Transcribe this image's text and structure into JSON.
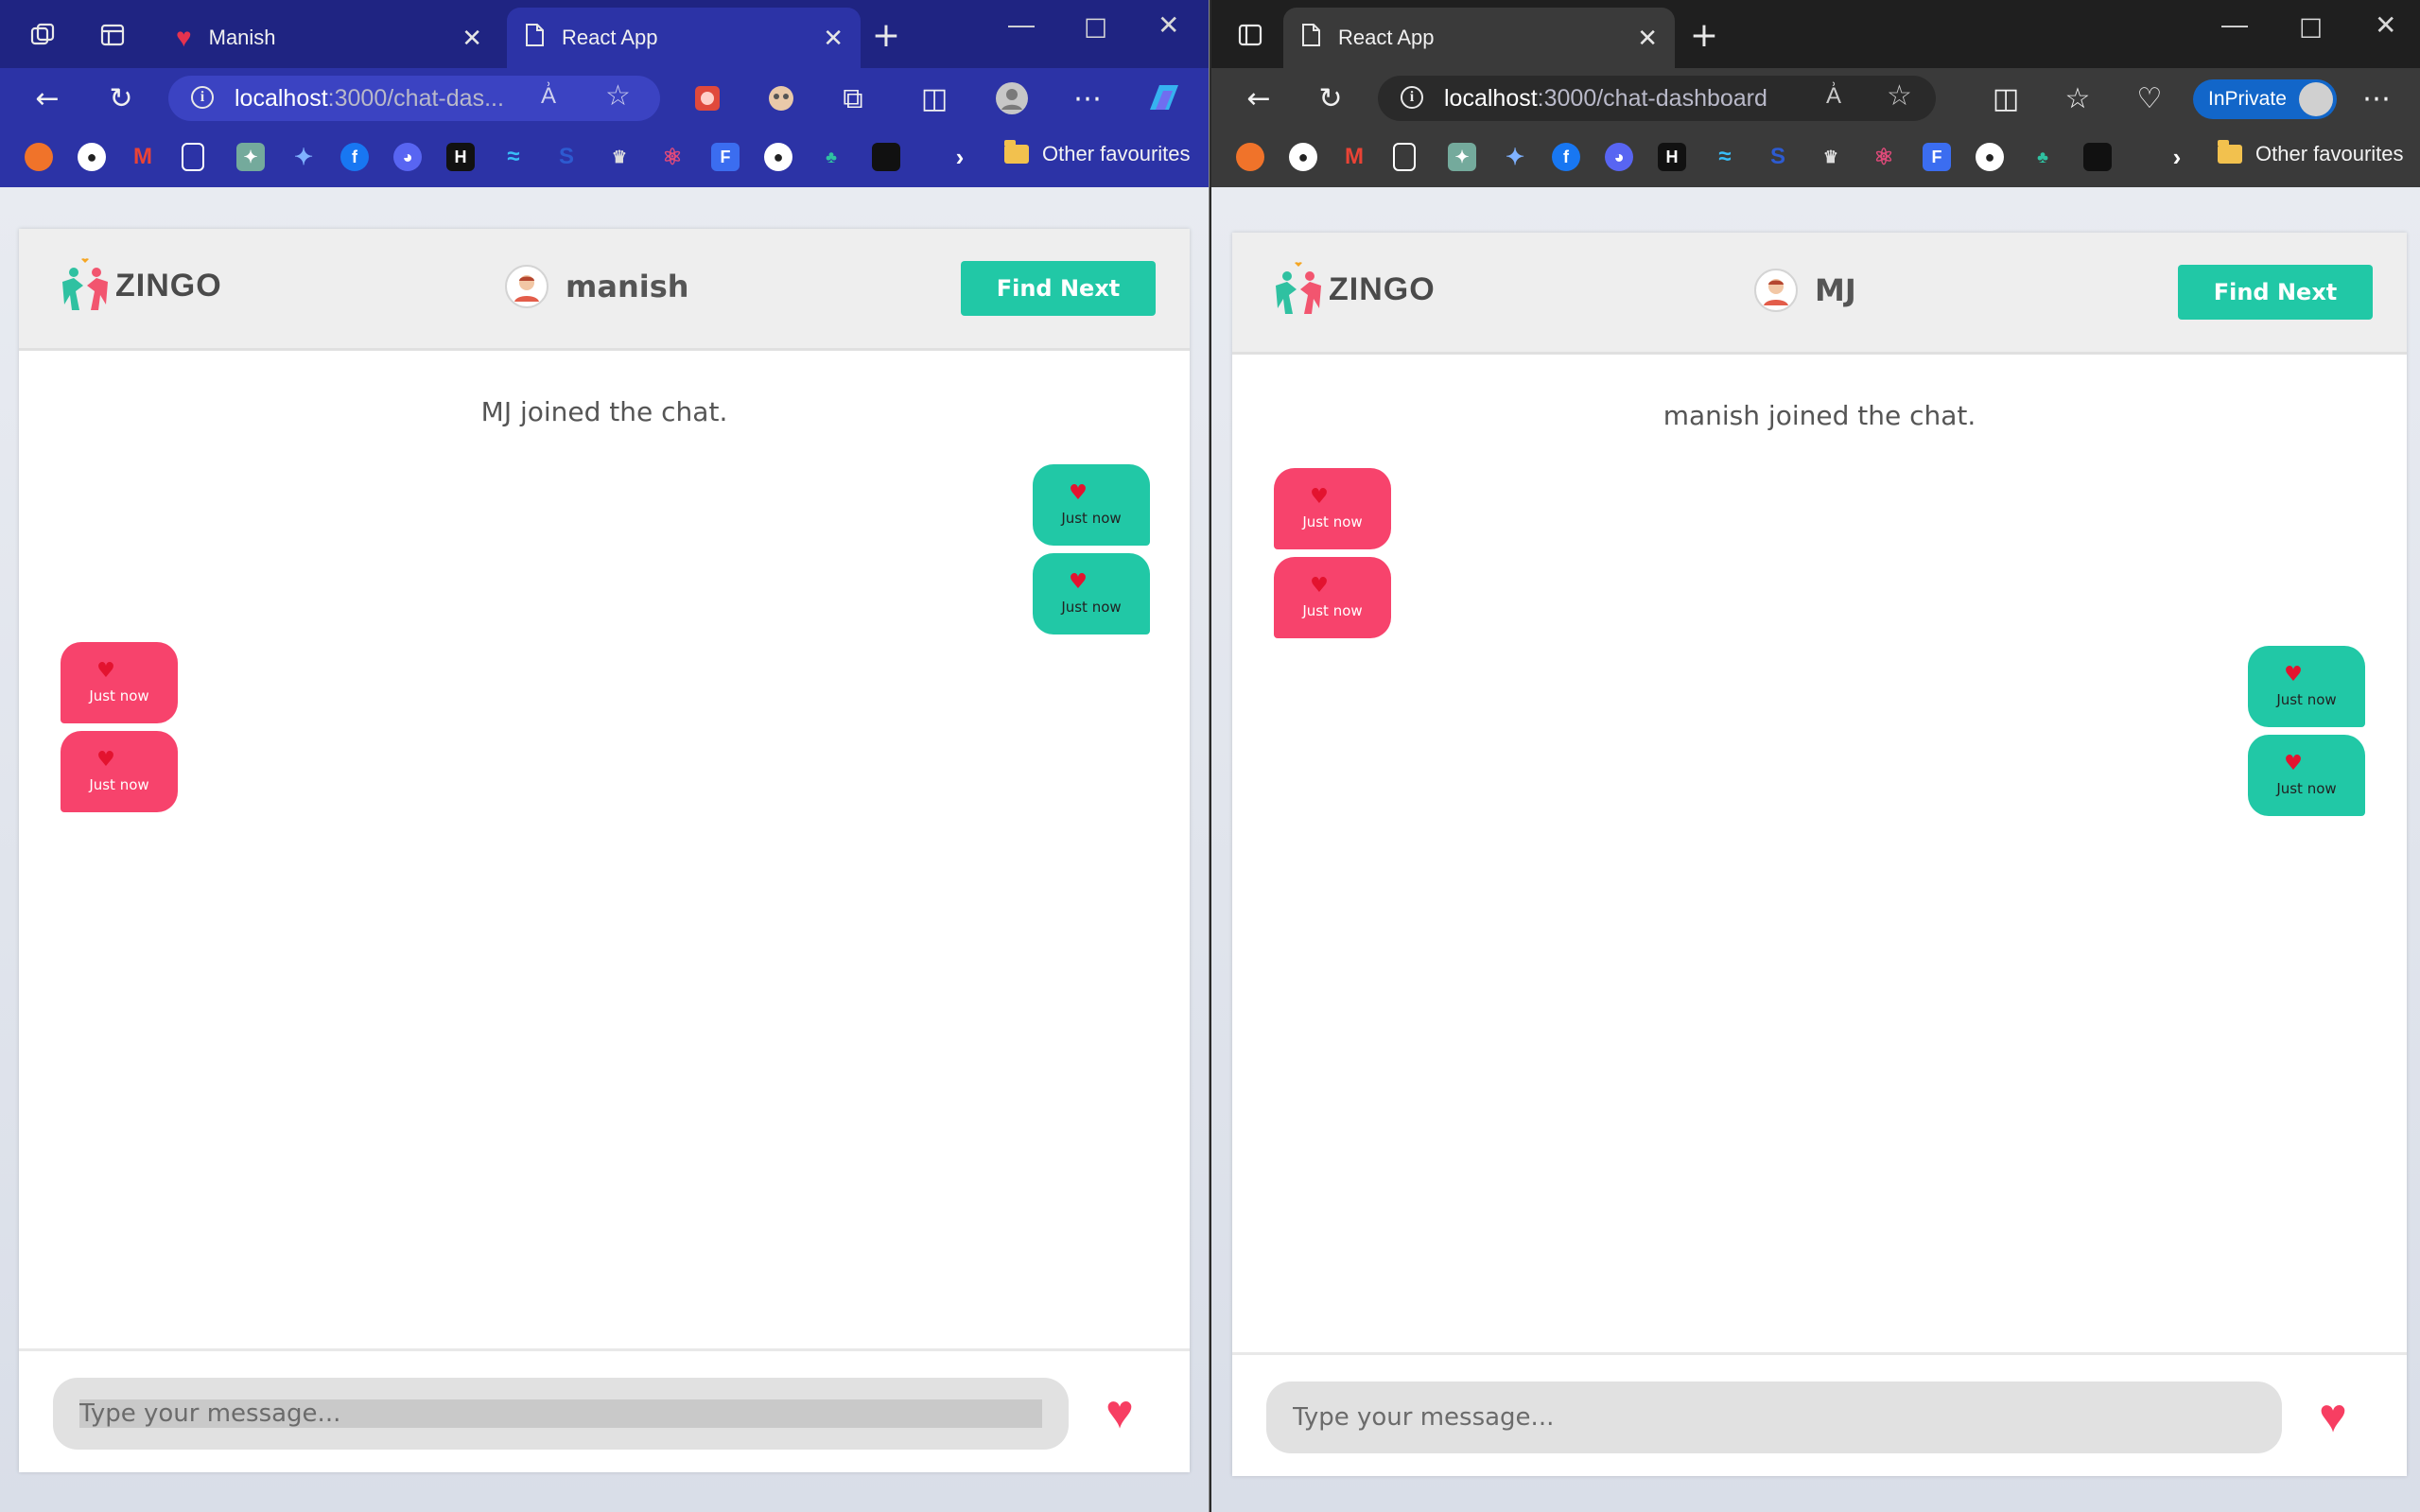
{
  "left_window": {
    "tabs": [
      {
        "label": "Manish",
        "active": false
      },
      {
        "label": "React App",
        "active": true
      }
    ],
    "url": {
      "host": "localhost",
      "path": ":3000/chat-das..."
    },
    "favourites_folder": "Other favourites",
    "app": {
      "logo_text": "ZINGO",
      "peer_name": "manish",
      "find_next_label": "Find Next",
      "system_message": "MJ joined the chat.",
      "messages": [
        {
          "type": "sent",
          "time": "Just now"
        },
        {
          "type": "sent",
          "time": "Just now"
        },
        {
          "type": "received",
          "time": "Just now"
        },
        {
          "type": "received",
          "time": "Just now"
        }
      ],
      "input_placeholder": "Type your message..."
    }
  },
  "right_window": {
    "tabs": [
      {
        "label": "React App",
        "active": true
      }
    ],
    "url": {
      "host": "localhost",
      "path": ":3000/chat-dashboard"
    },
    "inprivate_label": "InPrivate",
    "favourites_folder": "Other favourites",
    "app": {
      "logo_text": "ZINGO",
      "peer_name": "MJ",
      "find_next_label": "Find Next",
      "system_message": "manish joined the chat.",
      "messages": [
        {
          "type": "received",
          "time": "Just now"
        },
        {
          "type": "received",
          "time": "Just now"
        },
        {
          "type": "sent",
          "time": "Just now"
        },
        {
          "type": "sent",
          "time": "Just now"
        }
      ],
      "input_placeholder": "Type your message..."
    }
  },
  "colors": {
    "accent_teal": "#21c8a6",
    "accent_pink": "#f7436c",
    "left_chrome": "#2c33a6",
    "right_chrome": "#3a3a3a"
  }
}
